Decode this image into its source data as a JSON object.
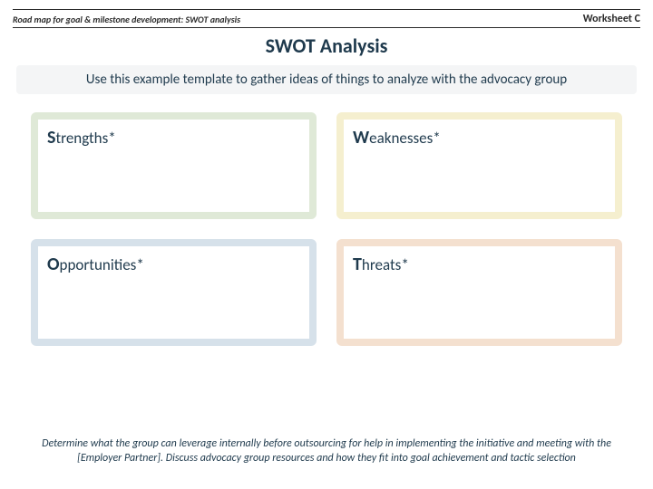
{
  "header": {
    "breadcrumb": "Road map for goal & milestone development: SWOT analysis",
    "worksheet": "Worksheet C"
  },
  "title": "SWOT Analysis",
  "instruction": "Use this example template to gather ideas of things to analyze with the advocacy group",
  "swot": {
    "strengths": {
      "cap": "S",
      "rest": "trengths*"
    },
    "weaknesses": {
      "cap": "W",
      "rest": "eaknesses*"
    },
    "opportunities": {
      "cap": "O",
      "rest": "pportunities*"
    },
    "threats": {
      "cap": "T",
      "rest": "hreats*"
    }
  },
  "footnote": "Determine what the group can leverage internally before outsourcing for help in implementing the initiative and meeting with the [Employer Partner]. Discuss advocacy group resources and how they fit into goal achievement and tactic selection"
}
